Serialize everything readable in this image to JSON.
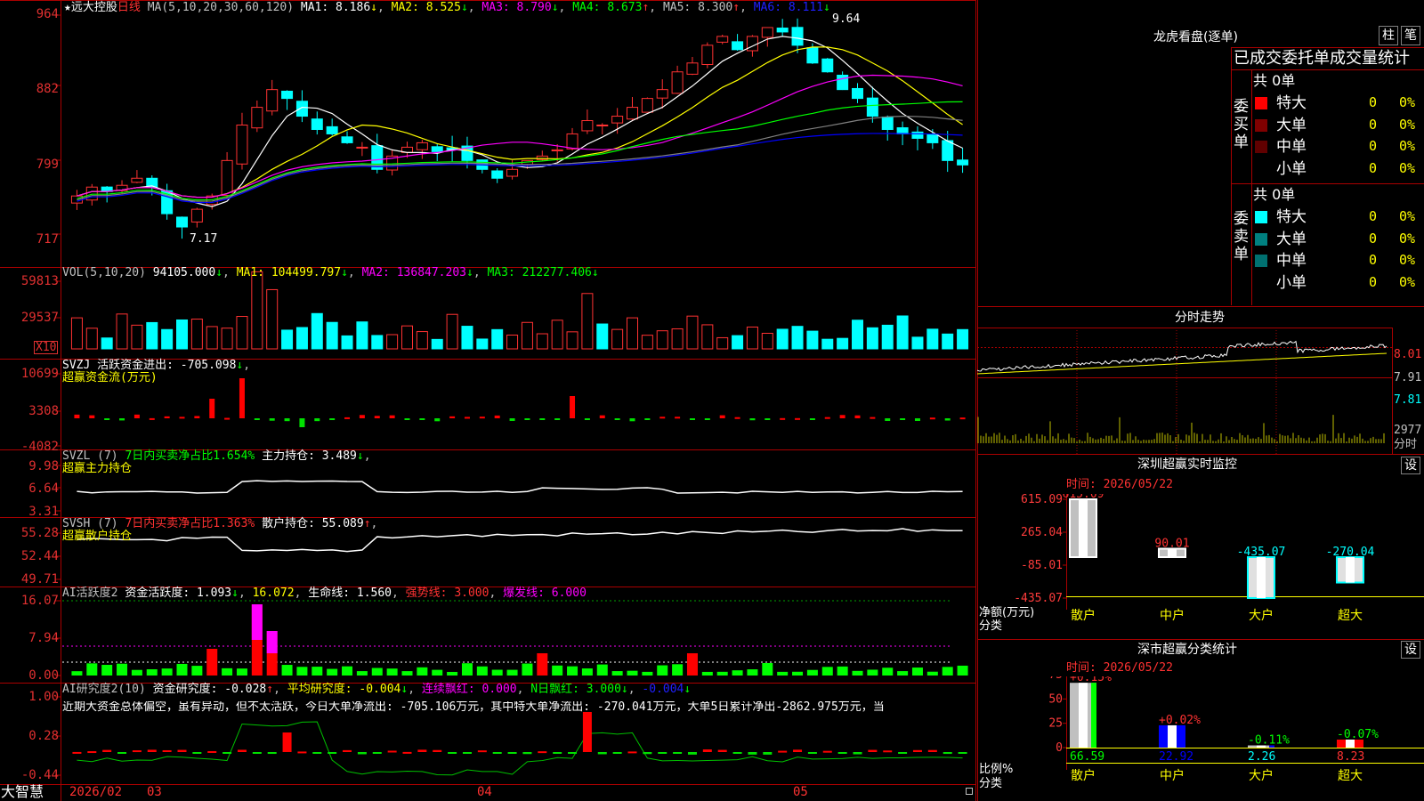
{
  "colors": {
    "up": "#ff3232",
    "down": "#00ffff",
    "grid": "#aa0000",
    "axis_text": "#ff3c3c",
    "ma1": "#ffffff",
    "ma2": "#ffff00",
    "ma3": "#ff00ff",
    "ma4": "#00ff00",
    "ma5": "#808080",
    "ma6": "#0000ff",
    "tag_red": "#ff0000",
    "tag_cyan": "#00ffff"
  },
  "kline": {
    "stock_name": "远大控股",
    "period": "日线",
    "ma_params": "MA(5,10,20,30,60,120)",
    "ma1": "MA1: 8.186",
    "ma2": "MA2: 8.525",
    "ma3": "MA3: 8.790",
    "ma4": "MA4: 8.673",
    "ma5": "MA5: 8.300",
    "ma6": "MA6: 8.111",
    "y_ticks": [
      "964",
      "882",
      "799",
      "717"
    ],
    "high_label": "9.64",
    "low_label": "7.17"
  },
  "vol": {
    "title": "VOL(5,10,20)",
    "value": "94105.000",
    "ma1": "MA1: 104499.797",
    "ma2": "MA2: 136847.203",
    "ma3": "MA3: 212277.406",
    "y_ticks": [
      "59813",
      "29537"
    ],
    "unit": "X10"
  },
  "svzj": {
    "title": "SVZJ  活跃资金进出: -705.098",
    "subtitle": "超赢资金流(万元)",
    "y_ticks": [
      "10699",
      "3308",
      "-4082"
    ]
  },
  "svzl": {
    "title": "SVZL (7)",
    "ratio": "7日内买卖净占比1.654%",
    "hold": "主力持仓: 3.489",
    "subtitle": "超赢主力持仓",
    "y_ticks": [
      "9.98",
      "6.64",
      "3.31"
    ]
  },
  "svsh": {
    "title": "SVSH (7)",
    "ratio": "7日内买卖净占比1.363%",
    "hold": "散户持仓: 55.089",
    "subtitle": "超赢散户持仓",
    "y_ticks": [
      "55.28",
      "52.44",
      "49.71"
    ]
  },
  "aihy": {
    "title": "AI活跃度2",
    "v1": "资金活跃度: 1.093",
    "v2": "16.072",
    "v3": "生命线: 1.560",
    "v4": "强势线: 3.000",
    "v5": "爆发线: 6.000",
    "y_ticks": [
      "16.07",
      "7.94",
      "0.00"
    ]
  },
  "aiyj": {
    "title": "AI研究度2(10)",
    "v1": "资金研究度: -0.028",
    "v2": "平均研究度: -0.004",
    "v3": "连续飘红: 0.000",
    "v4": "N日飘红: 3.000",
    "v5": "-0.004",
    "comment": "近期大资金总体偏空，虽有异动，但不太活跃，今日大单净流出: -705.106万元，其中特大单净流出: -270.041万元，大单5日累计净出-2862.975万元，当",
    "y_ticks": [
      "1.00",
      "0.28",
      "-0.44"
    ]
  },
  "bottom": {
    "brand": "大智慧",
    "date": "2026/02",
    "months": [
      "03",
      "04",
      "05"
    ]
  },
  "dragon": {
    "title": "龙虎看盘(逐单)",
    "btn1": "柱",
    "btn2": "笔",
    "header": "已成交委托单成交量统计",
    "buy_label": "委买单",
    "sell_label": "委卖单",
    "buy_total": "共 0单",
    "sell_total": "共 0单",
    "buy_rows": [
      {
        "name": "特大",
        "n": "0",
        "p": "0%",
        "color": "#ff0000"
      },
      {
        "name": "大单",
        "n": "0",
        "p": "0%",
        "color": "#800000"
      },
      {
        "name": "中单",
        "n": "0",
        "p": "0%",
        "color": "#600000"
      },
      {
        "name": "小单",
        "n": "0",
        "p": "0%",
        "color": ""
      }
    ],
    "sell_rows": [
      {
        "name": "特大",
        "n": "0",
        "p": "0%",
        "color": "#00ffff"
      },
      {
        "name": "大单",
        "n": "0",
        "p": "0%",
        "color": "#008080"
      },
      {
        "name": "中单",
        "n": "0",
        "p": "0%",
        "color": "#007070"
      },
      {
        "name": "小单",
        "n": "0",
        "p": "0%",
        "color": ""
      }
    ]
  },
  "intraday": {
    "title": "分时走势",
    "y_ticks": [
      "8.01",
      "7.91",
      "7.81"
    ],
    "vol_tick": "2977",
    "vol_unit": "分时"
  },
  "monitor": {
    "title": "深圳超赢实时监控",
    "btn": "设",
    "time": "时间: 2026/05/22",
    "y_ticks": [
      "615.09",
      "265.04",
      "-85.01",
      "-435.07"
    ],
    "ylabel": "净额(万元)",
    "xlabel": "分类",
    "bars": [
      {
        "cat": "散户",
        "val": "615.09",
        "v": 615.09
      },
      {
        "cat": "中户",
        "val": "90.01",
        "v": 90.01
      },
      {
        "cat": "大户",
        "val": "-435.07",
        "v": -435.07
      },
      {
        "cat": "超大",
        "val": "-270.04",
        "v": -270.04
      }
    ]
  },
  "stats": {
    "title": "深市超赢分类统计",
    "btn": "设",
    "time": "时间: 2026/05/22",
    "y_ticks": [
      "75",
      "50",
      "25",
      "0"
    ],
    "ylabel": "比例%",
    "xlabel": "分类",
    "bars": [
      {
        "cat": "散户",
        "val": "66.59",
        "chg": "+0.15%",
        "v": 66.59
      },
      {
        "cat": "中户",
        "val": "22.92",
        "chg": "+0.02%",
        "v": 22.92
      },
      {
        "cat": "大户",
        "val": "2.26",
        "chg": "-0.11%",
        "v": 2.26
      },
      {
        "cat": "超大",
        "val": "8.23",
        "chg": "-0.07%",
        "v": 8.23
      }
    ]
  }
}
